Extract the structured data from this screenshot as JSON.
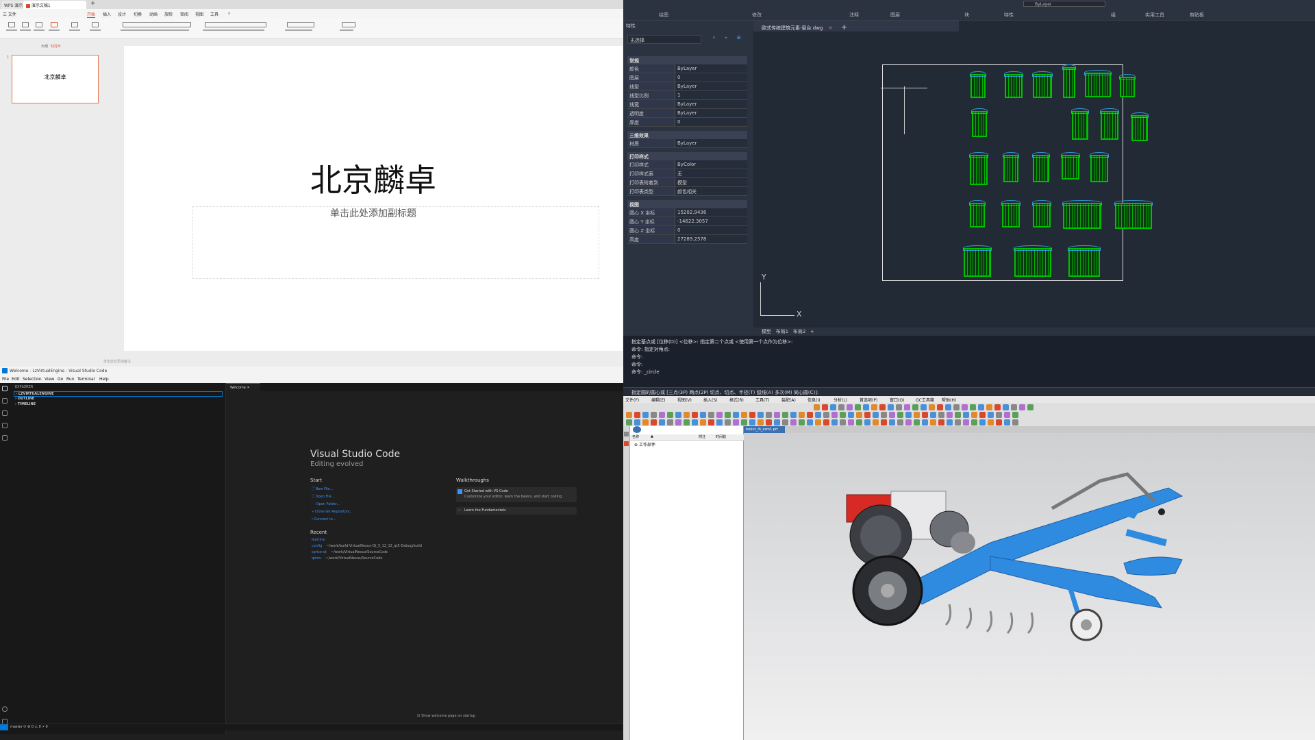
{
  "wps": {
    "tabs": [
      "WPS 演示",
      "演示文稿1"
    ],
    "menu": [
      "三 文件",
      "开始",
      "插入",
      "设计",
      "切换",
      "动画",
      "放映",
      "审阅",
      "视图",
      "工具"
    ],
    "side_tabs": [
      "大纲",
      "幻灯片"
    ],
    "slide_number": "1",
    "thumb_title": "北京麟卓",
    "title": "北京麟卓",
    "subtitle_placeholder": "单击此处添加副标题",
    "notes_placeholder": "单击此处添加备注"
  },
  "cad": {
    "ribbon_labels": [
      "绘图",
      "修改",
      "注释",
      "图层",
      "块",
      "特性",
      "组",
      "实用工具",
      "剪贴板"
    ],
    "bylayer_top": "ByLayer",
    "panel_title": "特性",
    "selection": "无选择",
    "sections": [
      {
        "title": "常规",
        "rows": [
          [
            "颜色",
            "ByLayer"
          ],
          [
            "图层",
            "0"
          ],
          [
            "线型",
            "ByLayer"
          ],
          [
            "线型比例",
            "1"
          ],
          [
            "线宽",
            "ByLayer"
          ],
          [
            "透明度",
            "ByLayer"
          ],
          [
            "厚度",
            "0"
          ]
        ]
      },
      {
        "title": "三维效果",
        "rows": [
          [
            "材质",
            "ByLayer"
          ]
        ]
      },
      {
        "title": "打印样式",
        "rows": [
          [
            "打印样式",
            "ByColor"
          ],
          [
            "打印样式表",
            "无"
          ],
          [
            "打印表附着到",
            "模型"
          ],
          [
            "打印表类型",
            "颜色相关"
          ]
        ]
      },
      {
        "title": "视图",
        "rows": [
          [
            "圆心 X 坐标",
            "15202.9436"
          ],
          [
            "圆心 Y 坐标",
            "-14622.3057"
          ],
          [
            "圆心 Z 坐标",
            "0"
          ],
          [
            "高度",
            "27289.2578"
          ]
        ]
      }
    ],
    "doc_tab": "欧式传统建筑元素-窗台.dwg",
    "layout_tabs": [
      "模型",
      "布局1",
      "布局2",
      "+"
    ],
    "cmd_lines": [
      "指定基点或 [位移(D)] <位移>:  指定第二个点或 <使用第一个点作为位移>:",
      "命令: 指定对角点:",
      "命令:",
      "命令:",
      "命令: _circle"
    ],
    "cmd_prompt": "指定圆的圆心或 [三点(3P) 两点(2P) 切点、切点、半径(T) 弧线(A) 多次(M) 同心圆(C)]:",
    "axis_y": "Y",
    "axis_x": "X"
  },
  "vsc": {
    "title": "Welcome - LzVirtualEngine - Visual Studio Code",
    "menu": [
      "File",
      "Edit",
      "Selection",
      "View",
      "Go",
      "Run",
      "Terminal",
      "Help"
    ],
    "explorer_title": "EXPLORER",
    "tree": [
      "LZVIRTUALENGINE",
      "OUTLINE",
      "TIMELINE"
    ],
    "tab": "Welcome",
    "heading": "Visual Studio Code",
    "subheading": "Editing evolved",
    "start_title": "Start",
    "start_links": [
      "New File...",
      "Open File...",
      "Open Folder...",
      "Clone Git Repository...",
      "Connect to..."
    ],
    "recent_title": "Recent",
    "recent": [
      [
        "lbertine",
        ""
      ],
      [
        "config",
        "~/work/build-VirtualNexus-Qt_5_12_12_qt5-Debug/build"
      ],
      [
        "sprice-qt",
        "~/work/VirtualNexus/SourceCode"
      ],
      [
        "qemu",
        "~/work/VirtualNexus/SourceCode"
      ]
    ],
    "walk_title": "Walkthroughs",
    "walk1_title": "Get Started with VS Code",
    "walk1_desc": "Customize your editor, learn the basics, and start coding",
    "walk2_title": "Learn the Fundamentals",
    "show_welcome": "Show welcome page on startup",
    "status_left": "master ⟳  ⊗ 0 ⚠ 0   ⚡ 0"
  },
  "nx": {
    "menu": [
      "文件(F)",
      "编辑(E)",
      "视图(V)",
      "插入(S)",
      "格式(R)",
      "工具(T)",
      "装配(A)",
      "信息(I)",
      "分析(L)",
      "首选项(P)",
      "窗口(O)",
      "GC工具箱",
      "帮助(H)"
    ],
    "nav_header": [
      "名称",
      "▲",
      "附注",
      "时间戳"
    ],
    "nav_item": "工作部件",
    "part_tab": "toolcs_lh_asm1.prt"
  }
}
